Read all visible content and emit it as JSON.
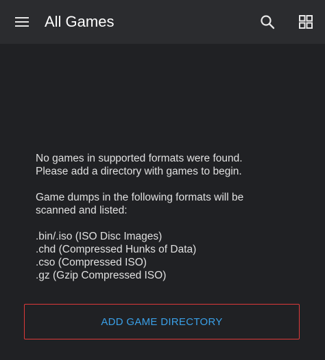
{
  "appbar": {
    "title": "All Games",
    "icons": {
      "menu": "menu-icon",
      "search": "search-icon",
      "view": "grid-view-icon"
    }
  },
  "message": {
    "line1": "No games in supported formats were found.",
    "line2": "Please add a directory with games to begin.",
    "formats_intro_line1": "Game dumps in the following formats will be",
    "formats_intro_line2": "scanned and listed:",
    "formats": [
      ".bin/.iso (ISO Disc Images)",
      ".chd (Compressed Hunks of Data)",
      ".cso (Compressed ISO)",
      ".gz (Gzip Compressed ISO)"
    ]
  },
  "actions": {
    "add_directory_label": "ADD GAME DIRECTORY"
  },
  "colors": {
    "background": "#202124",
    "appbar": "#2b2c2f",
    "accent_text": "#3aa0e8",
    "button_border": "#e03a3a"
  }
}
